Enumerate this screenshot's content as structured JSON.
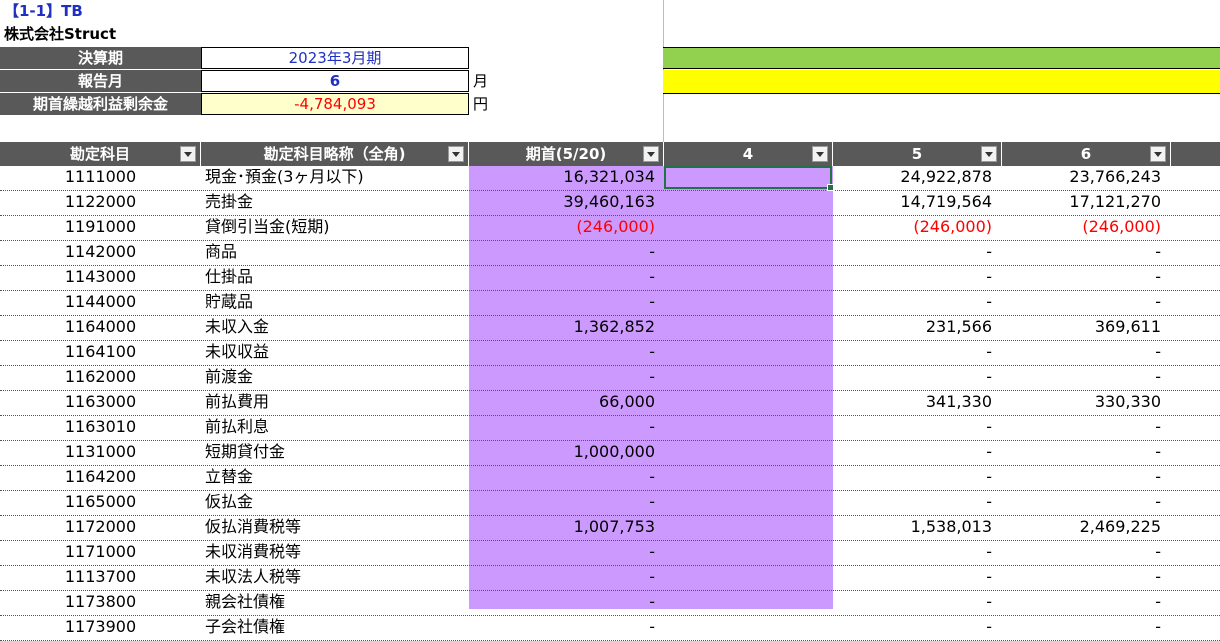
{
  "sheet_title": "【1-1】TB",
  "company": "株式会社Struct",
  "params": [
    {
      "label": "決算期",
      "value": "2023年3月期",
      "unit": ""
    },
    {
      "label": "報告月",
      "value": "6",
      "unit": "月"
    },
    {
      "label": "期首繰越利益剰余金",
      "value": "-4,784,093",
      "unit": "円"
    }
  ],
  "headers": [
    "勘定科目",
    "勘定科目略称（全角)",
    "期首(5/20)",
    "4",
    "5",
    "6"
  ],
  "rows": [
    {
      "code": "1111000",
      "name": "現金･預金(3ヶ月以下)",
      "opening": "16,321,034",
      "m4": "",
      "m5": "24,922,878",
      "m6": "23,766,243"
    },
    {
      "code": "1122000",
      "name": "売掛金",
      "opening": "39,460,163",
      "m4": "",
      "m5": "14,719,564",
      "m6": "17,121,270"
    },
    {
      "code": "1191000",
      "name": "貸倒引当金(短期)",
      "opening": "(246,000)",
      "m4": "",
      "m5": "(246,000)",
      "m6": "(246,000)"
    },
    {
      "code": "1142000",
      "name": "商品",
      "opening": "-",
      "m4": "",
      "m5": "-",
      "m6": "-"
    },
    {
      "code": "1143000",
      "name": "仕掛品",
      "opening": "-",
      "m4": "",
      "m5": "-",
      "m6": "-"
    },
    {
      "code": "1144000",
      "name": "貯蔵品",
      "opening": "-",
      "m4": "",
      "m5": "-",
      "m6": "-"
    },
    {
      "code": "1164000",
      "name": "未収入金",
      "opening": "1,362,852",
      "m4": "",
      "m5": "231,566",
      "m6": "369,611"
    },
    {
      "code": "1164100",
      "name": "未収収益",
      "opening": "-",
      "m4": "",
      "m5": "-",
      "m6": "-"
    },
    {
      "code": "1162000",
      "name": "前渡金",
      "opening": "-",
      "m4": "",
      "m5": "-",
      "m6": "-"
    },
    {
      "code": "1163000",
      "name": "前払費用",
      "opening": "66,000",
      "m4": "",
      "m5": "341,330",
      "m6": "330,330"
    },
    {
      "code": "1163010",
      "name": "前払利息",
      "opening": "-",
      "m4": "",
      "m5": "-",
      "m6": "-"
    },
    {
      "code": "1131000",
      "name": "短期貸付金",
      "opening": "1,000,000",
      "m4": "",
      "m5": "-",
      "m6": "-"
    },
    {
      "code": "1164200",
      "name": "立替金",
      "opening": "-",
      "m4": "",
      "m5": "-",
      "m6": "-"
    },
    {
      "code": "1165000",
      "name": "仮払金",
      "opening": "-",
      "m4": "",
      "m5": "-",
      "m6": "-"
    },
    {
      "code": "1172000",
      "name": "仮払消費税等",
      "opening": "1,007,753",
      "m4": "",
      "m5": "1,538,013",
      "m6": "2,469,225"
    },
    {
      "code": "1171000",
      "name": "未収消費税等",
      "opening": "-",
      "m4": "",
      "m5": "-",
      "m6": "-"
    },
    {
      "code": "1113700",
      "name": "未収法人税等",
      "opening": "-",
      "m4": "",
      "m5": "-",
      "m6": "-"
    },
    {
      "code": "1173800",
      "name": "親会社債権",
      "opening": "-",
      "m4": "",
      "m5": "-",
      "m6": "-"
    },
    {
      "code": "1173900",
      "name": "子会社債権",
      "opening": "-",
      "m4": "",
      "m5": "-",
      "m6": "-"
    }
  ],
  "colors": {
    "header_bg": "#595959",
    "input_bg": "#ffffcc",
    "highlight_purple": "#cc99ff",
    "bar_green": "#92d050",
    "bar_yellow": "#ffff00",
    "negative": "#ff0000",
    "title_blue": "#1f2fbf"
  }
}
